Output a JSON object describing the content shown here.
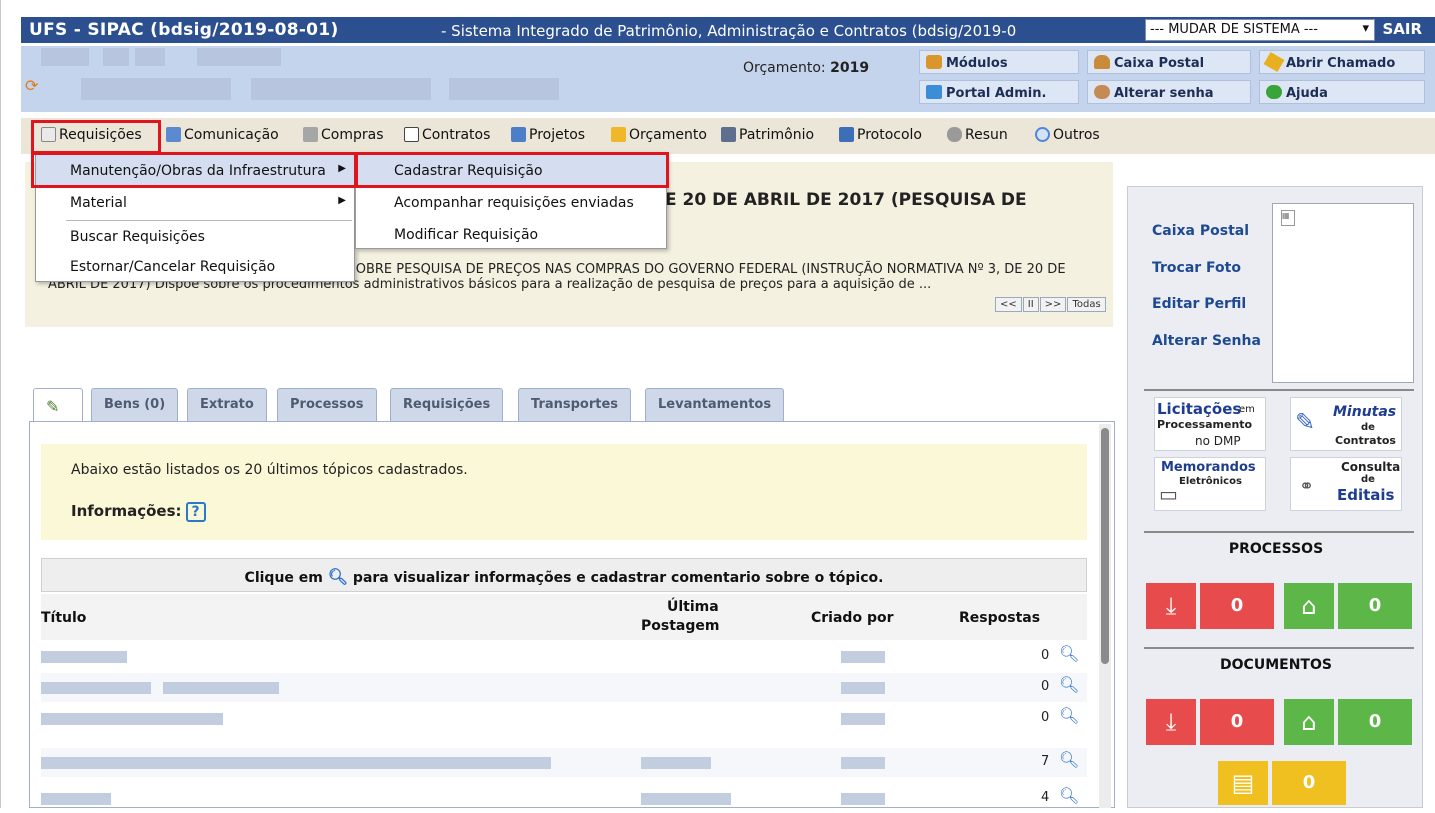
{
  "app": {
    "title": "UFS - SIPAC (bdsig/2019-08-01)",
    "subtitle": "- Sistema Integrado de Patrimônio, Administração e Contratos (bdsig/2019-0",
    "system_select": "--- MUDAR DE SISTEMA ---",
    "logout": "SAIR"
  },
  "header": {
    "budget_label": "Orçamento:",
    "budget_year": "2019",
    "buttons": {
      "modulos": "Módulos",
      "caixa_postal": "Caixa Postal",
      "abrir_chamado": "Abrir Chamado",
      "portal_admin": "Portal Admin.",
      "alterar_senha": "Alterar senha",
      "ajuda": "Ajuda"
    }
  },
  "menu": {
    "requisicoes": "Requisições",
    "comunicacao": "Comunicação",
    "compras": "Compras",
    "contratos": "Contratos",
    "projetos": "Projetos",
    "orcamento": "Orçamento",
    "patrimonio": "Patrimônio",
    "protocolo": "Protocolo",
    "resun": "Resun",
    "outros": "Outros"
  },
  "dropdown": {
    "items": [
      "Manutenção/Obras da Infraestrutura",
      "Material",
      "Buscar Requisições",
      "Estornar/Cancelar Requisição"
    ],
    "submenu": [
      "Cadastrar Requisição",
      "Acompanhar requisições enviadas",
      "Modificar Requisição"
    ]
  },
  "news": {
    "title": "E 20 DE ABRIL DE 2017 (PESQUISA DE",
    "text": "RM, divulgam: NOVA INSTRUÇÃO NORMATIVA SOBRE PESQUISA DE PREÇOS NAS COMPRAS DO GOVERNO FEDERAL (INSTRUÇÃO NORMATIVA Nº 3, DE 20 DE ABRIL DE 2017) Dispõe sobre os procedimentos administrativos básicos para a realização de pesquisa de preços para a aquisição de ...",
    "nav": [
      "<<",
      "II",
      ">>",
      "Todas"
    ]
  },
  "tabs": [
    "Bens (0)",
    "Extrato",
    "Processos",
    "Requisições",
    "Transportes",
    "Levantamentos"
  ],
  "forum": {
    "intro": "Abaixo estão listados os 20 últimos tópicos cadastrados.",
    "info_label": "Informações:",
    "caption_pre": "Clique em",
    "caption_post": "para visualizar informações e cadastrar comentario sobre o tópico.",
    "columns": {
      "title": "Título",
      "last_post_1": "Última",
      "last_post_2": "Postagem",
      "created_by": "Criado por",
      "replies": "Respostas"
    },
    "rows": [
      {
        "replies": "0"
      },
      {
        "replies": "0"
      },
      {
        "replies": "0"
      },
      {
        "replies": "7"
      },
      {
        "replies": "4"
      }
    ]
  },
  "sidebar": {
    "links": [
      "Caixa Postal",
      "Trocar Foto",
      "Editar Perfil",
      "Alterar Senha"
    ],
    "quick": {
      "licitacoes_1": "Licitações",
      "licitacoes_2": "em",
      "licitacoes_3": "Processamento",
      "licitacoes_4": "no DMP",
      "minutas_1": "Minutas",
      "minutas_2": "de",
      "minutas_3": "Contratos",
      "memorandos_1": "Memorandos",
      "memorandos_2": "Eletrônicos",
      "consulta_1": "Consulta",
      "consulta_2": "de",
      "consulta_3": "Editais"
    },
    "processos_label": "PROCESSOS",
    "documentos_label": "DOCUMENTOS",
    "processos_received": "0",
    "processos_home": "0",
    "documentos_received": "0",
    "documentos_home": "0",
    "memos": "0"
  },
  "colors": {
    "topbar": "#2b4f8f",
    "header": "#c5d4ed",
    "menubar": "#ebe6d7",
    "highlight_border": "#e0141c",
    "tile_red": "#e84b4b",
    "tile_green": "#5db748",
    "tile_yellow": "#f0c020"
  }
}
